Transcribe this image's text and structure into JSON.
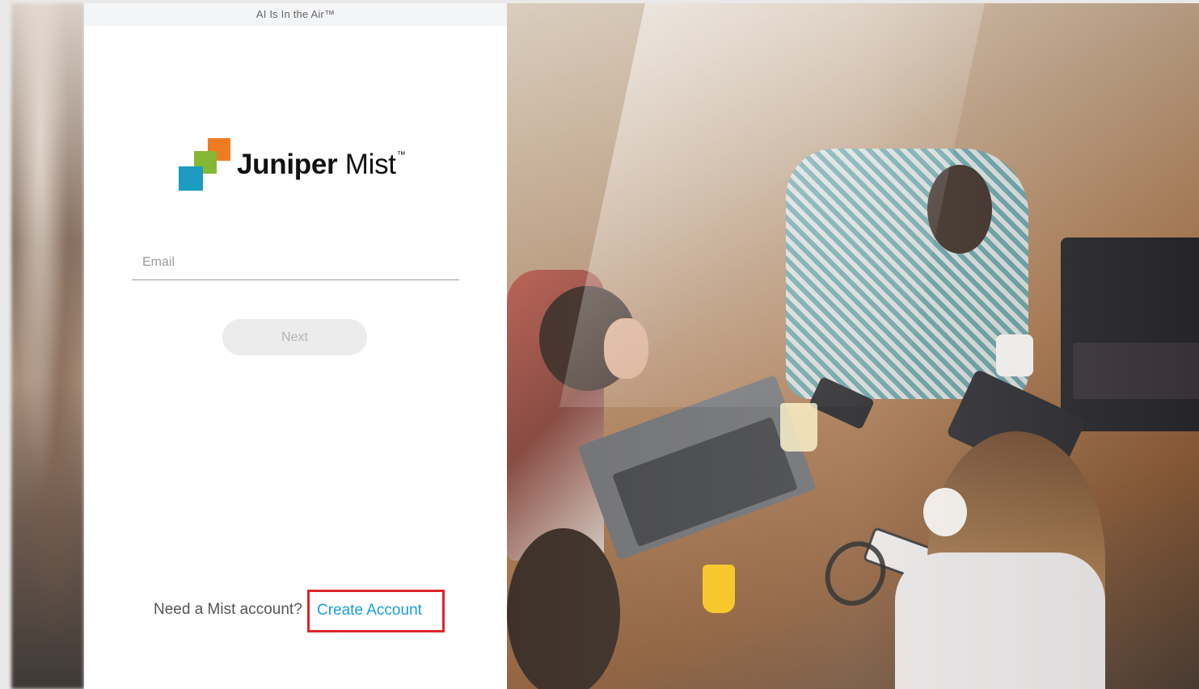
{
  "panel": {
    "tagline": "AI Is In the Air™"
  },
  "logo": {
    "brand_bold": "Juniper",
    "brand_regular": "Mist",
    "trademark": "™",
    "colors": {
      "orange": "#f07c22",
      "green": "#84b834",
      "teal": "#1b9cc0"
    }
  },
  "login": {
    "email_placeholder": "Email",
    "email_value": "",
    "next_label": "Next"
  },
  "signup": {
    "prompt": "Need a Mist account?",
    "link_label": "Create Account",
    "link_color": "#1a9fd6",
    "highlight_color": "#e0242b"
  },
  "background": {
    "image": "overhead-photo-people-working-laptops-cafe-table"
  }
}
